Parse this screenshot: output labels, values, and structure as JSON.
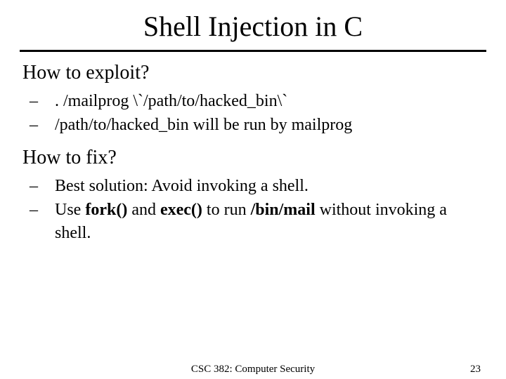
{
  "title": "Shell Injection in C",
  "sections": [
    {
      "heading": "How to exploit?",
      "bullets": [
        {
          "pre": ". /mailprog \\`/path/to/hacked_bin\\`"
        },
        {
          "pre": "/path/to/hacked_bin will be run by mailprog"
        }
      ]
    },
    {
      "heading": "How to fix?",
      "bullets": [
        {
          "pre": "Best solution: Avoid invoking a shell."
        },
        {
          "pre": "Use ",
          "b1": "fork()",
          "mid1": " and ",
          "b2": "exec()",
          "mid2": " to run ",
          "b3": "/bin/mail",
          "post": " without invoking a shell."
        }
      ]
    }
  ],
  "footer": {
    "center": "CSC 382: Computer Security",
    "right": "23"
  },
  "dash": "–"
}
